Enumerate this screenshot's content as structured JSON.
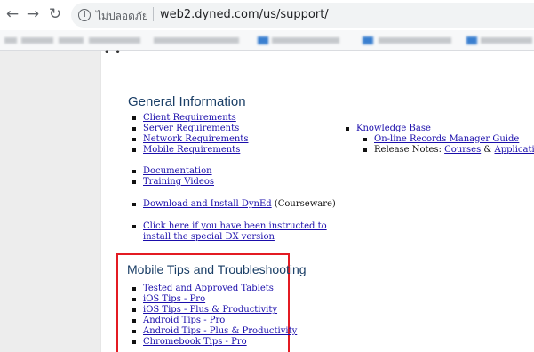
{
  "browser": {
    "security_label": "ไม่ปลอดภัย",
    "url": "web2.dyned.com/us/support/"
  },
  "general": {
    "title": "General Information",
    "group1": [
      "Client Requirements",
      "Server Requirements",
      "Network Requirements",
      "Mobile Requirements"
    ],
    "group2": [
      "Documentation",
      "Training Videos"
    ],
    "download": {
      "link": "Download and Install DynEd",
      "suffix": " (Courseware)"
    },
    "dx": {
      "line1": "Click here if you have been instructed to",
      "line2": "install the special DX version"
    }
  },
  "knowledge": {
    "title": "Knowledge Base",
    "records": "On-line Records Manager Guide",
    "release_label": "Release Notes: ",
    "courses": "Courses",
    "amp": " & ",
    "applications": "Applications"
  },
  "mobile": {
    "title": "Mobile Tips and Troubleshooting",
    "items": [
      "Tested and Approved Tablets",
      "iOS Tips - Pro",
      "iOS Tips - Plus & Productivity",
      "Android Tips - Pro",
      "Android Tips - Plus & Productivity",
      "Chromebook Tips - Pro"
    ]
  },
  "icons": {
    "back": "back-arrow-icon",
    "forward": "forward-arrow-icon",
    "reload": "reload-icon",
    "info": "info-icon"
  },
  "colors": {
    "link": "#1a0dab",
    "heading": "#1a3e66",
    "highlight_box": "#e31b23"
  }
}
